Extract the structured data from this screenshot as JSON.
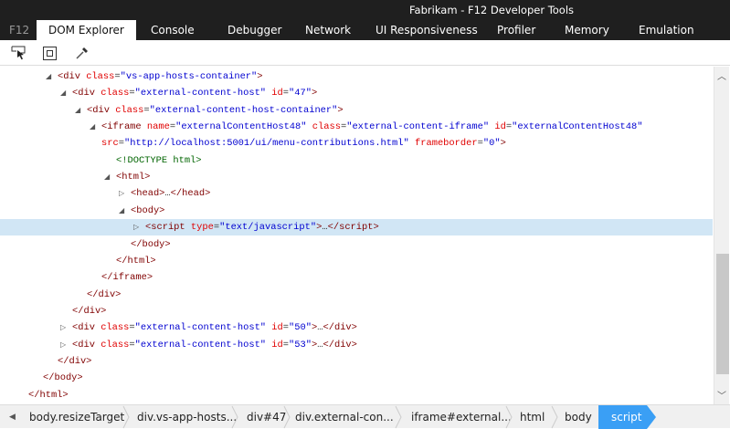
{
  "window": {
    "title": "Fabrikam - F12 Developer Tools"
  },
  "tabs": [
    {
      "label": "F12"
    },
    {
      "label": "DOM Explorer",
      "active": true
    },
    {
      "label": "Console"
    },
    {
      "label": "Debugger"
    },
    {
      "label": "Network"
    },
    {
      "label": "UI Responsiveness"
    },
    {
      "label": "Profiler"
    },
    {
      "label": "Memory"
    },
    {
      "label": "Emulation"
    }
  ],
  "toolbar": {
    "icons": [
      "select-element-icon",
      "highlight-box-icon",
      "color-picker-icon"
    ]
  },
  "tree": {
    "lines": [
      {
        "level": 1,
        "toggle": "expanded",
        "parts": [
          [
            "tag",
            "<div "
          ],
          [
            "an",
            "class"
          ],
          [
            "pn",
            "="
          ],
          [
            "av",
            "\"vs-app-hosts-container\""
          ],
          [
            "tag",
            ">"
          ]
        ]
      },
      {
        "level": 2,
        "toggle": "expanded",
        "parts": [
          [
            "tag",
            "<div "
          ],
          [
            "an",
            "class"
          ],
          [
            "pn",
            "="
          ],
          [
            "av",
            "\"external-content-host\""
          ],
          [
            "pn",
            " "
          ],
          [
            "an",
            "id"
          ],
          [
            "pn",
            "="
          ],
          [
            "av",
            "\"47\""
          ],
          [
            "tag",
            ">"
          ]
        ]
      },
      {
        "level": 3,
        "toggle": "expanded",
        "parts": [
          [
            "tag",
            "<div "
          ],
          [
            "an",
            "class"
          ],
          [
            "pn",
            "="
          ],
          [
            "av",
            "\"external-content-host-container\""
          ],
          [
            "tag",
            ">"
          ]
        ]
      },
      {
        "level": 4,
        "toggle": "expanded",
        "parts": [
          [
            "tag",
            "<iframe "
          ],
          [
            "an",
            "name"
          ],
          [
            "pn",
            "="
          ],
          [
            "av",
            "\"externalContentHost48\""
          ],
          [
            "pn",
            " "
          ],
          [
            "an",
            "class"
          ],
          [
            "pn",
            "="
          ],
          [
            "av",
            "\"external-content-iframe\""
          ],
          [
            "pn",
            " "
          ],
          [
            "an",
            "id"
          ],
          [
            "pn",
            "="
          ],
          [
            "av",
            "\"externalContentHost48\""
          ]
        ]
      },
      {
        "level": 4,
        "toggle": "none",
        "parts": [
          [
            "an",
            "src"
          ],
          [
            "pn",
            "="
          ],
          [
            "av",
            "\"http://localhost:5001/ui/menu-contributions.html\""
          ],
          [
            "pn",
            " "
          ],
          [
            "an",
            "frameborder"
          ],
          [
            "pn",
            "="
          ],
          [
            "av",
            "\"0\""
          ],
          [
            "tag",
            ">"
          ]
        ]
      },
      {
        "level": 5,
        "toggle": "none",
        "parts": [
          [
            "dt",
            "<!DOCTYPE html>"
          ]
        ]
      },
      {
        "level": 5,
        "toggle": "expanded",
        "parts": [
          [
            "tag",
            "<html>"
          ]
        ]
      },
      {
        "level": 6,
        "toggle": "collapsed",
        "parts": [
          [
            "tag",
            "<head>"
          ],
          [
            "pn",
            "…"
          ],
          [
            "tag",
            "</head>"
          ]
        ]
      },
      {
        "level": 6,
        "toggle": "expanded",
        "parts": [
          [
            "tag",
            "<body>"
          ]
        ]
      },
      {
        "level": 7,
        "toggle": "collapsed",
        "selected": true,
        "parts": [
          [
            "tag",
            "<script "
          ],
          [
            "an",
            "type"
          ],
          [
            "pn",
            "="
          ],
          [
            "av",
            "\"text/javascript\""
          ],
          [
            "tag",
            ">"
          ],
          [
            "pn",
            "…"
          ],
          [
            "tag",
            "</script>"
          ]
        ]
      },
      {
        "level": 6,
        "toggle": "none",
        "parts": [
          [
            "tag",
            "</body>"
          ]
        ]
      },
      {
        "level": 5,
        "toggle": "none",
        "parts": [
          [
            "tag",
            "</html>"
          ]
        ]
      },
      {
        "level": 4,
        "toggle": "none",
        "parts": [
          [
            "tag",
            "</iframe>"
          ]
        ]
      },
      {
        "level": 3,
        "toggle": "none",
        "parts": [
          [
            "tag",
            "</div>"
          ]
        ]
      },
      {
        "level": 2,
        "toggle": "none",
        "parts": [
          [
            "tag",
            "</div>"
          ]
        ]
      },
      {
        "level": 2,
        "toggle": "collapsed",
        "parts": [
          [
            "tag",
            "<div "
          ],
          [
            "an",
            "class"
          ],
          [
            "pn",
            "="
          ],
          [
            "av",
            "\"external-content-host\""
          ],
          [
            "pn",
            " "
          ],
          [
            "an",
            "id"
          ],
          [
            "pn",
            "="
          ],
          [
            "av",
            "\"50\""
          ],
          [
            "tag",
            ">"
          ],
          [
            "pn",
            "…"
          ],
          [
            "tag",
            "</div>"
          ]
        ]
      },
      {
        "level": 2,
        "toggle": "collapsed",
        "parts": [
          [
            "tag",
            "<div "
          ],
          [
            "an",
            "class"
          ],
          [
            "pn",
            "="
          ],
          [
            "av",
            "\"external-content-host\""
          ],
          [
            "pn",
            " "
          ],
          [
            "an",
            "id"
          ],
          [
            "pn",
            "="
          ],
          [
            "av",
            "\"53\""
          ],
          [
            "tag",
            ">"
          ],
          [
            "pn",
            "…"
          ],
          [
            "tag",
            "</div>"
          ]
        ]
      },
      {
        "level": 1,
        "toggle": "none",
        "parts": [
          [
            "tag",
            "</div>"
          ]
        ]
      },
      {
        "level": 0,
        "toggle": "none",
        "parts": [
          [
            "tag",
            "</body>"
          ]
        ]
      },
      {
        "level": -1,
        "toggle": "none",
        "parts": [
          [
            "tag",
            "</html>"
          ]
        ]
      }
    ]
  },
  "breadcrumb": {
    "items": [
      "body.resizeTarget",
      "div.vs-app-hosts...",
      "div#47",
      "div.external-con...",
      "iframe#external...",
      "html",
      "body",
      "script"
    ],
    "active_index": 7
  },
  "colors": {
    "titlebar": "#1f1f1f",
    "selected_row": "#d1e6f5",
    "active_crumb": "#3a9ff5"
  }
}
